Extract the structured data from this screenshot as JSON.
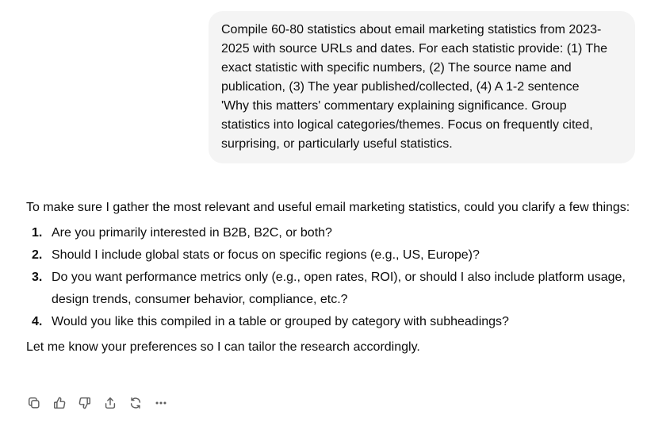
{
  "user_message": {
    "text": "Compile 60-80 statistics about email marketing statistics from 2023-\n2025 with source URLs and dates. For each statistic provide: (1) The\nexact statistic with specific numbers, (2) The source name and\npublication, (3) The year published/collected, (4) A 1-2 sentence\n'Why this matters' commentary explaining significance. Group\nstatistics into logical categories/themes. Focus on frequently cited,\nsurprising, or particularly useful statistics."
  },
  "assistant_message": {
    "intro": "To make sure I gather the most relevant and useful email marketing statistics, could you clarify a few things:",
    "questions": [
      {
        "number": "1.",
        "text": "Are you primarily interested in B2B, B2C, or both?"
      },
      {
        "number": "2.",
        "text": "Should I include global stats or focus on specific regions (e.g., US, Europe)?"
      },
      {
        "number": "3.",
        "text": "Do you want performance metrics only (e.g., open rates, ROI), or should I also include platform usage, design trends, consumer behavior, compliance, etc.?"
      },
      {
        "number": "4.",
        "text": "Would you like this compiled in a table or grouped by category with subheadings?"
      }
    ],
    "outro": "Let me know your preferences so I can tailor the research accordingly."
  },
  "action_icons": [
    "copy-icon",
    "thumbs-up-icon",
    "thumbs-down-icon",
    "share-icon",
    "regenerate-icon",
    "more-icon"
  ]
}
